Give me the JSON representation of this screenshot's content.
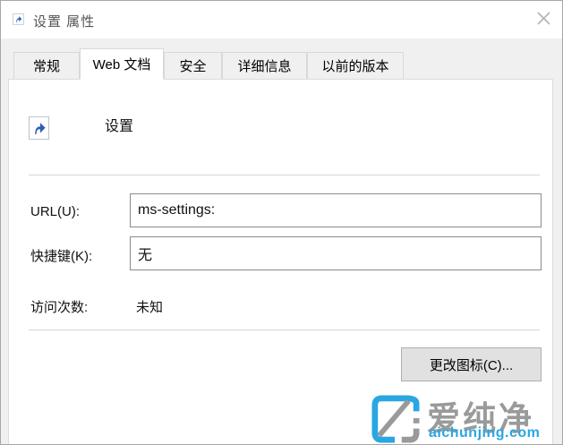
{
  "window": {
    "title": "设置 属性"
  },
  "tabs": [
    {
      "label": "常规",
      "active": false
    },
    {
      "label": "Web 文档",
      "active": true
    },
    {
      "label": "安全",
      "active": false
    },
    {
      "label": "详细信息",
      "active": false
    },
    {
      "label": "以前的版本",
      "active": false
    }
  ],
  "content": {
    "shortcut_name": "设置",
    "fields": [
      {
        "label": "URL(U):",
        "value": "ms-settings:",
        "type": "input"
      },
      {
        "label": "快捷键(K):",
        "value": "无",
        "type": "input"
      },
      {
        "label": "访问次数:",
        "value": "未知",
        "type": "static"
      }
    ],
    "change_icon_button": "更改图标(C)..."
  },
  "watermark": {
    "brand": "爱纯净",
    "site": "aichunjing.com"
  },
  "icons": {
    "titlebar": "shortcut-arrow-icon",
    "close": "close-icon",
    "shortcut_overlay": "shortcut-arrow-icon",
    "watermark": "aichunjing-logo-icon"
  },
  "colors": {
    "accent_blue": "#29a7e2",
    "brand_gray": "#9a9a9a",
    "shortcut_arrow_blue": "#2a5bb6",
    "dialog_bg": "#f0f0f0",
    "panel_bg": "#ffffff",
    "button_bg": "#e1e1e1",
    "button_border": "#adadad",
    "input_border": "#8b8b8b"
  }
}
